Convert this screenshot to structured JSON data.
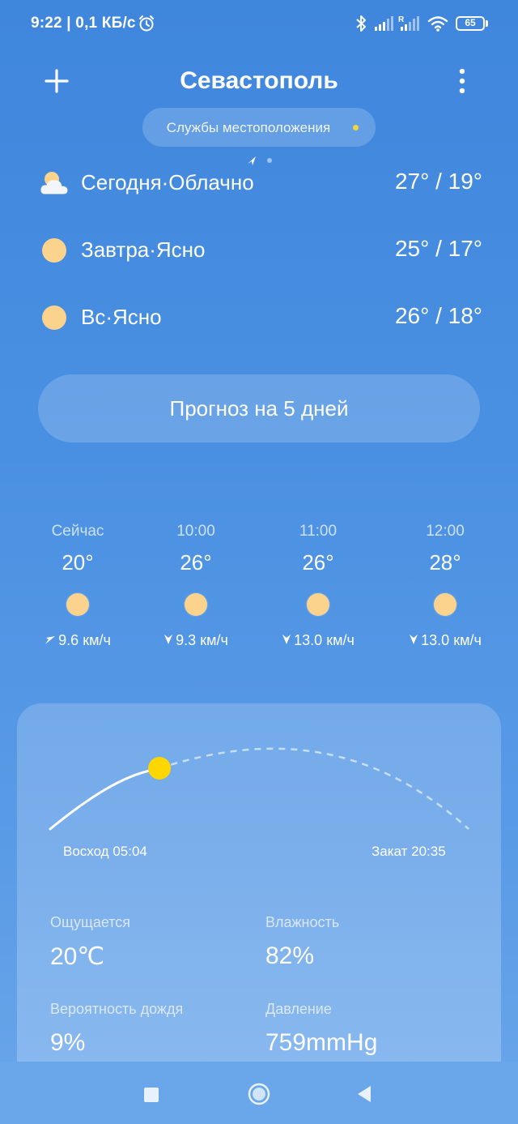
{
  "status_bar": {
    "time_speed": "9:22 | 0,1 КБ/с",
    "battery_level": "65"
  },
  "header": {
    "city": "Севастополь",
    "location_label": "Службы местоположения"
  },
  "daily": [
    {
      "label": "Сегодня·Облачно",
      "temp": "27° / 19°",
      "icon": "partly-cloudy-icon"
    },
    {
      "label": "Завтра·Ясно",
      "temp": "25° / 17°",
      "icon": "sun-icon"
    },
    {
      "label": "Вс·Ясно",
      "temp": "26° / 18°",
      "icon": "sun-icon"
    }
  ],
  "forecast_button": "Прогноз на 5 дней",
  "hourly": [
    {
      "time": "Сейчас",
      "temp": "20°",
      "wind": "9.6 км/ч",
      "wind_icon": "wind-direction-northeast-icon"
    },
    {
      "time": "10:00",
      "temp": "26°",
      "wind": "9.3 км/ч",
      "wind_icon": "wind-direction-south-icon"
    },
    {
      "time": "11:00",
      "temp": "26°",
      "wind": "13.0 км/ч",
      "wind_icon": "wind-direction-south-icon"
    },
    {
      "time": "12:00",
      "temp": "28°",
      "wind": "13.0 км/ч",
      "wind_icon": "wind-direction-south-icon"
    }
  ],
  "sun": {
    "sunrise": "Восход 05:04",
    "sunset": "Закат 20:35"
  },
  "details": {
    "feels_like": {
      "label": "Ощущается",
      "value": "20℃"
    },
    "humidity": {
      "label": "Влажность",
      "value": "82%"
    },
    "rain_chance": {
      "label": "Вероятность дождя",
      "value": "9%"
    },
    "pressure": {
      "label": "Давление",
      "value": "759mmHg"
    }
  },
  "colors": {
    "background": "#4a90e2",
    "sun": "#fcd38c",
    "sun_position": "#ffd700",
    "location_dot": "#f5d53a"
  }
}
